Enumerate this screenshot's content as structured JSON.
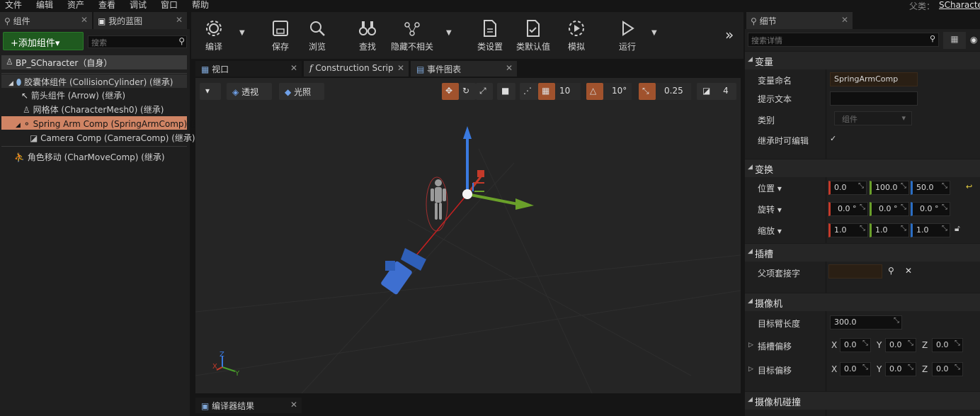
{
  "menu": {
    "items": [
      "文件",
      "编辑",
      "资产",
      "查看",
      "调试",
      "窗口",
      "帮助"
    ],
    "parent_label": "父类：",
    "parent_class": "SCharacte"
  },
  "components_panel": {
    "tab_components": "组件",
    "tab_blueprint": "我的蓝图",
    "add_button": "+添加组件▾",
    "search_placeholder": "搜索",
    "self_row": "BP_SCharacter（自身）",
    "tree": [
      "胶囊体组件 (CollisionCylinder) (继承)",
      "箭头组件 (Arrow) (继承)",
      "网格体 (CharacterMesh0) (继承)",
      "Spring Arm Comp (SpringArmComp) (继承",
      "Camera Comp (CameraComp) (继承)",
      "角色移动 (CharMoveComp) (继承)"
    ]
  },
  "toolbar": {
    "compile": "编译",
    "save": "保存",
    "browse": "浏览",
    "find": "查找",
    "hide": "隐藏不相关",
    "class_settings": "类设置",
    "class_defaults": "类默认值",
    "simulate": "模拟",
    "run": "运行"
  },
  "editor_tabs": {
    "viewport": "视口",
    "construction": "Construction Scrip",
    "event_graph": "事件图表"
  },
  "viewport": {
    "perspective": "透视",
    "lit": "光照",
    "grid_snap": "10",
    "rot_snap": "10°",
    "scale_snap": "0.25",
    "cam_speed": "4",
    "axis_x": "X",
    "axis_y": "Y",
    "axis_z": "Z"
  },
  "compiler": {
    "tab": "编译器结果"
  },
  "details": {
    "tab": "细节",
    "search_placeholder": "搜索详情",
    "sec_variable": "变量",
    "var_name_label": "变量命名",
    "var_name_value": "SpringArmComp",
    "tooltip_label": "提示文本",
    "category_label": "类别",
    "category_value": "组件",
    "editable_label": "继承时可编辑",
    "sec_transform": "变换",
    "location_label": "位置 ▾",
    "location": [
      "0.0",
      "100.0",
      "50.0"
    ],
    "rotation_label": "旋转 ▾",
    "rotation": [
      "0.0 °",
      "0.0 °",
      "0.0 °"
    ],
    "scale_label": "缩放 ▾",
    "scale": [
      "1.0",
      "1.0",
      "1.0"
    ],
    "sec_socket": "插槽",
    "parent_socket_label": "父项套接字",
    "sec_camera": "摄像机",
    "arm_length_label": "目标臂长度",
    "arm_length": "300.0",
    "socket_offset_label": "插槽偏移",
    "target_offset_label": "目标偏移",
    "offset_values": [
      "0.0",
      "0.0",
      "0.0"
    ],
    "axis_letters": [
      "X",
      "Y",
      "Z"
    ],
    "sec_collision": "摄像机碰撞"
  },
  "colors": {
    "accent_orange": "#d08464",
    "add_green": "#1f5a1f",
    "axis_red": "#c43a2a",
    "axis_green": "#6aa02a",
    "axis_blue": "#2a6ec4"
  }
}
